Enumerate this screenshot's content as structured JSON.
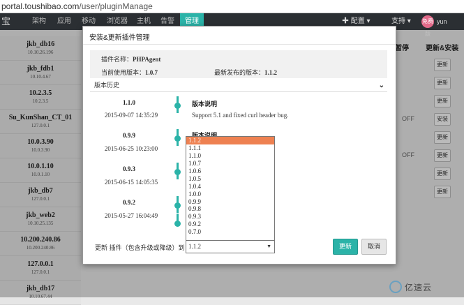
{
  "browser": {
    "url_host": "portal.toushibao.com",
    "url_path": "/user/pluginManage"
  },
  "topnav": {
    "logo": "宝",
    "items": [
      {
        "label": "架构",
        "active": false
      },
      {
        "label": "应用",
        "active": false
      },
      {
        "label": "移动",
        "active": false
      },
      {
        "label": "浏览器",
        "active": false
      },
      {
        "label": "主机",
        "active": false
      },
      {
        "label": "告警",
        "active": false
      },
      {
        "label": "管理",
        "active": true
      }
    ],
    "config": "✚ 配置 ▾",
    "support": "支持 ▾",
    "avatar_text": "免费版",
    "user": "yun"
  },
  "hosts": [
    {
      "name": "jkb_db16",
      "ip": "10.10.26.196"
    },
    {
      "name": "jkb_fdb1",
      "ip": "10.10.4.67"
    },
    {
      "name": "10.2.3.5",
      "ip": "10.2.3.5"
    },
    {
      "name": "Su_KunShan_CT_01",
      "ip": "127.0.0.1"
    },
    {
      "name": "10.0.3.90",
      "ip": "10.0.3.90"
    },
    {
      "name": "10.0.1.10",
      "ip": "10.0.1.10"
    },
    {
      "name": "jkb_db7",
      "ip": "127.0.0.1"
    },
    {
      "name": "jkb_web2",
      "ip": "10.10.25.135"
    },
    {
      "name": "10.200.240.86",
      "ip": "10.200.240.86"
    },
    {
      "name": "127.0.0.1",
      "ip": "127.0.0.1"
    },
    {
      "name": "jkb_db17",
      "ip": "10.10.67.44"
    }
  ],
  "right_cols": {
    "pause_header": "暂停",
    "update_header": "更新&安装",
    "rows": [
      {
        "off": "",
        "btn": "更新"
      },
      {
        "off": "",
        "btn": "更新"
      },
      {
        "off": "",
        "btn": "更新"
      },
      {
        "off": "OFF",
        "btn": "安装"
      },
      {
        "off": "",
        "btn": "更新"
      },
      {
        "off": "OFF",
        "btn": "更新"
      },
      {
        "off": "",
        "btn": "更新"
      },
      {
        "off": "",
        "btn": "更新"
      }
    ]
  },
  "modal": {
    "title": "安装&更新插件管理",
    "plugin_name_label": "插件名称：",
    "plugin_name": "PHPAgent",
    "current_version_label": "当前使用版本：",
    "current_version": "1.0.7",
    "latest_version_label": "最新发布的版本：",
    "latest_version": "1.1.2",
    "history_label": "版本历史",
    "history": [
      {
        "version": "1.1.0",
        "date": "2015-09-07 14:35:29",
        "note_title": "版本说明",
        "note": "Support 5.1 and fixed curl header bug."
      },
      {
        "version": "0.9.9",
        "date": "2015-06-25 10:23:00",
        "note_title": "版本说明",
        "note": ""
      },
      {
        "version": "0.9.3",
        "date": "2015-06-15 14:05:35",
        "note_title": "",
        "note": ""
      },
      {
        "version": "0.9.2",
        "date": "2015-05-27 16:04:49",
        "note_title": "",
        "note": ""
      }
    ],
    "dropdown_options": [
      "1.1.2",
      "1.1.1",
      "1.1.0",
      "1.0.7",
      "1.0.6",
      "1.0.5",
      "1.0.4",
      "1.0.0",
      "0.9.9",
      "0.9.8",
      "0.9.3",
      "0.9.2",
      "0.7.0"
    ],
    "dropdown_selected": "1.1.2",
    "footer_label": "更新 插件（包含升级或降级）到",
    "update_button": "更新",
    "cancel_button": "取消"
  },
  "watermark": "亿速云"
}
